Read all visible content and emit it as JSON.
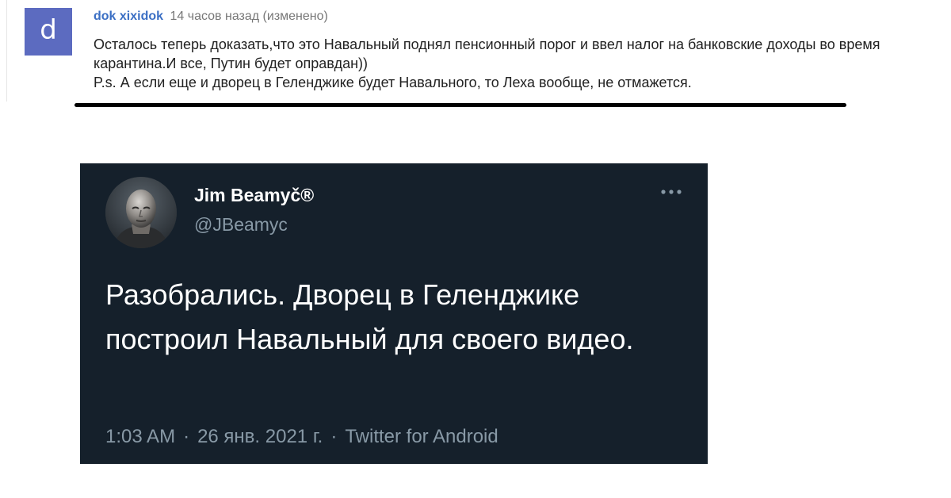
{
  "comment": {
    "avatar_letter": "d",
    "author": "dok xixidok",
    "meta": "14 часов назад (изменено)",
    "lines": [
      "Осталось теперь доказать,что это Навальный поднял пенсионный порог и ввел налог на банковские доходы во время карантина.И все, Путин будет оправдан))",
      "P.s. А если еще и дворец в Геленджике будет Навального, то Леха вообще, не отмажется."
    ]
  },
  "tweet": {
    "name": "Jim Beamyč®",
    "handle": "@JBeamyc",
    "text": "Разобрались. Дворец в Геленджике построил Навальный для своего видео.",
    "time": "1:03 AM",
    "date": "26 янв. 2021 г.",
    "source": "Twitter for Android",
    "separator": "·"
  },
  "colors": {
    "avatar_bg": "#5c6bc0",
    "author": "#3b6fc4",
    "tweet_bg": "#15202b",
    "tweet_muted": "#8899a6"
  },
  "icons": {
    "more": "more-horizontal-icon",
    "avatar_photo": "profile-photo"
  }
}
